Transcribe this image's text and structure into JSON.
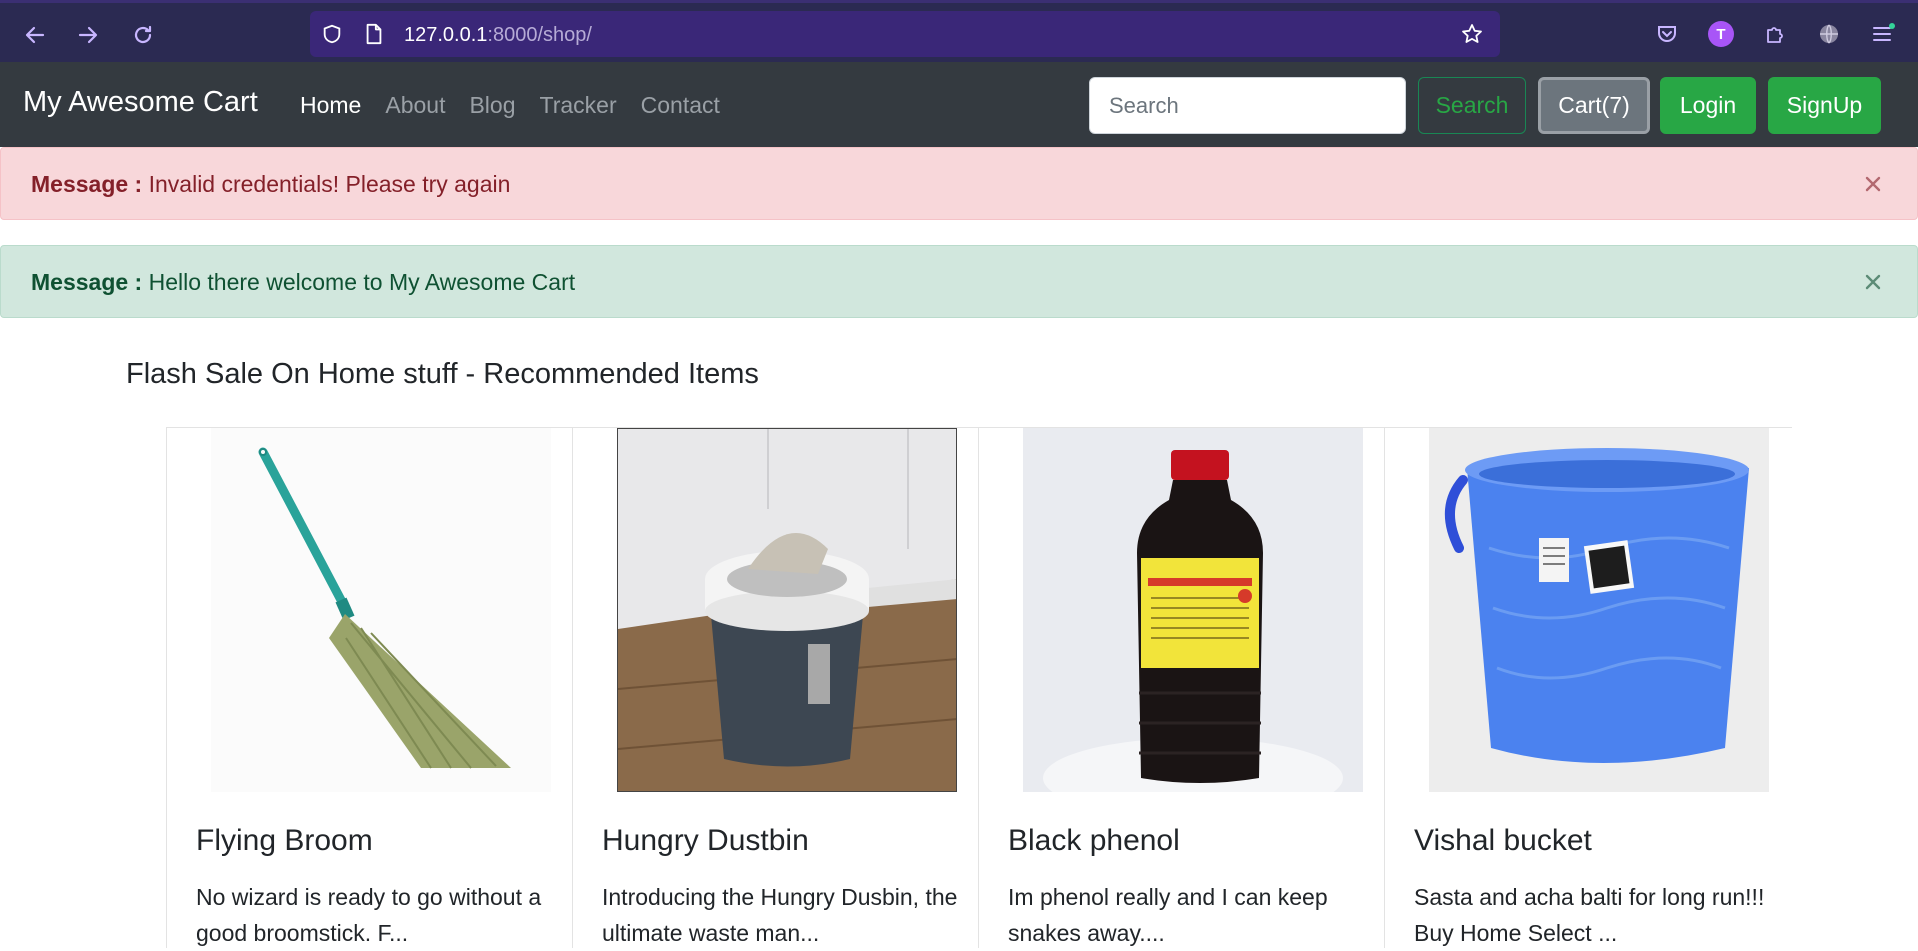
{
  "browser": {
    "url_host": "127.0.0.1",
    "url_path": ":8000/shop/",
    "profile_initial": "T"
  },
  "navbar": {
    "brand": "My Awesome Cart",
    "links": [
      "Home",
      "About",
      "Blog",
      "Tracker",
      "Contact"
    ],
    "active_link": "Home",
    "search_placeholder": "Search",
    "search_button": "Search",
    "cart_button": "Cart(7)",
    "login_button": "Login",
    "signup_button": "SignUp"
  },
  "alerts": [
    {
      "label": "Message :",
      "text": " Invalid credentials! Please try again",
      "type": "danger"
    },
    {
      "label": "Message :",
      "text": " Hello there welcome to My Awesome Cart",
      "type": "success"
    }
  ],
  "section": {
    "title": "Flash Sale On Home stuff - Recommended Items"
  },
  "products": [
    {
      "name": "Flying Broom",
      "desc": "No wizard is ready to go without a good broomstick. F..."
    },
    {
      "name": "Hungry Dustbin",
      "desc": "Introducing the Hungry Dusbin, the ultimate waste man..."
    },
    {
      "name": "Black phenol",
      "desc": "Im phenol really and I can keep snakes away...."
    },
    {
      "name": "Vishal bucket",
      "desc": "Sasta and acha balti for long run!!! Buy Home Select ..."
    }
  ],
  "colors": {
    "navbar_bg": "#343a40",
    "success": "#28a745",
    "cart_bg": "#6c757d",
    "browser_bg": "#2b2a52"
  },
  "icons": {
    "back": "back-arrow-icon",
    "forward": "forward-arrow-icon",
    "reload": "reload-icon",
    "shield": "shield-icon",
    "page": "page-icon",
    "bookmark": "star-icon",
    "pocket": "pocket-icon",
    "extensions": "puzzle-icon",
    "vpn": "globe-icon",
    "menu": "hamburger-menu-icon",
    "close": "close-icon"
  }
}
